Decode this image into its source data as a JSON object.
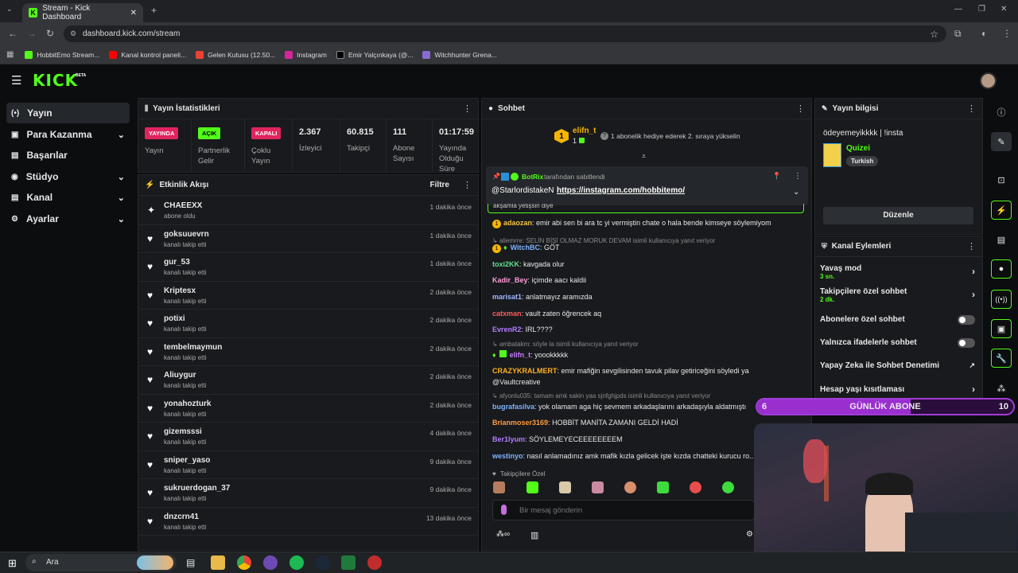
{
  "browser": {
    "tab_title": "Stream - Kick Dashboard",
    "url": "dashboard.kick.com/stream",
    "bookmarks": [
      "HobbitEmo Stream...",
      "Kanal kontrol paneli...",
      "Gelen Kutusu (12.50...",
      "Instagram",
      "Emir Yalçınkaya (@...",
      "Witchhunter Grena..."
    ]
  },
  "brand": {
    "logo": "KICK",
    "beta": "BETA",
    "accent": "#53fc18"
  },
  "sidebar": {
    "items": [
      {
        "label": "Yayın"
      },
      {
        "label": "Para Kazanma"
      },
      {
        "label": "Başarılar"
      },
      {
        "label": "Stüdyo"
      },
      {
        "label": "Kanal"
      },
      {
        "label": "Ayarlar"
      }
    ]
  },
  "stats": {
    "title": "Yayın İstatistikleri",
    "items": [
      {
        "badge": "YAYINDA",
        "label": "Yayın"
      },
      {
        "badge": "AÇIK",
        "label": "Partnerlik Gelir"
      },
      {
        "badge": "KAPALI",
        "label": "Çoklu Yayın"
      },
      {
        "value": "2.367",
        "label": "İzleyici"
      },
      {
        "value": "60.815",
        "label": "Takipçi"
      },
      {
        "value": "111",
        "label": "Abone Sayısı"
      },
      {
        "value": "01:17:59",
        "label": "Yayında Olduğu Süre"
      }
    ]
  },
  "activity": {
    "title": "Etkinlik Akışı",
    "filter": "Filtre",
    "events": [
      {
        "name": "CHAEEXX",
        "desc": "abone oldu",
        "time": "1 dakika önce"
      },
      {
        "name": "goksuuevrn",
        "desc": "kanalı takip etti",
        "time": "1 dakika önce"
      },
      {
        "name": "gur_53",
        "desc": "kanalı takip etti",
        "time": "1 dakika önce"
      },
      {
        "name": "Kriptesx",
        "desc": "kanalı takip etti",
        "time": "2 dakika önce"
      },
      {
        "name": "potixi",
        "desc": "kanalı takip etti",
        "time": "2 dakika önce"
      },
      {
        "name": "tembelmaymun",
        "desc": "kanalı takip etti",
        "time": "2 dakika önce"
      },
      {
        "name": "Aliuygur",
        "desc": "kanalı takip etti",
        "time": "2 dakika önce"
      },
      {
        "name": "yonahozturk",
        "desc": "kanalı takip etti",
        "time": "2 dakika önce"
      },
      {
        "name": "gizemsssi",
        "desc": "kanalı takip etti",
        "time": "4 dakika önce"
      },
      {
        "name": "sniper_yaso",
        "desc": "kanalı takip etti",
        "time": "9 dakika önce"
      },
      {
        "name": "sukruerdogan_37",
        "desc": "kanalı takip etti",
        "time": "9 dakika önce"
      },
      {
        "name": "dnzcrn41",
        "desc": "kanalı takip etti",
        "time": "13 dakika önce"
      }
    ]
  },
  "chat": {
    "title": "Sohbet",
    "top_user": "elifn_t",
    "top_rank": "1",
    "top_count": "1",
    "top_text": "1 abonelik hediye ederek 2. sıraya yükselin",
    "pinned_by": "BotRix",
    "pinned_suffix": "tarafından sabitlendi",
    "pinned_mention": "@StarlordistakeN",
    "pinned_link": "https://instagram.com/hobbitemo/",
    "partial_top": "akşamla yetişsin diye",
    "messages": [
      {
        "user": "adaozan",
        "text": "emir abi sen bi ara tc yi vermiştin chate o hala bende kimseye söylemiyom",
        "color": "#f5c542"
      },
      {
        "reply": "aliemrre: SELİN BİŞİ OLMAZ MORUK DEVAM isimli kullanıcıya yanıt veriyor"
      },
      {
        "user": "WitchBC",
        "text": "GÖT",
        "color": "#7fb2ff"
      },
      {
        "user": "toxi2KK",
        "text": "kavgada olur",
        "color": "#5ee08f"
      },
      {
        "user": "Kadir_Bey",
        "text": "içimde aacı kaldii",
        "color": "#ff9ad8"
      },
      {
        "user": "marisat1",
        "text": "anlatmayız aramızda",
        "color": "#9fb7ff"
      },
      {
        "user": "catxman",
        "text": "vault zaten öğrencek aq",
        "color": "#ff5b5b"
      },
      {
        "user": "EvrenR2",
        "text": "IRL????",
        "color": "#b37cff"
      },
      {
        "reply": "ambatakm: söyle la isimli kullanıcıya yanıt veriyor"
      },
      {
        "user": "elifn_t",
        "text": "yoookkkkk",
        "color": "#c77dff"
      },
      {
        "user": "CRAZYKRALMERT",
        "text": "emir mafiğin sevgilisinden tavuk pilav getiriceğini söyledi ya",
        "color": "#ffb020"
      },
      {
        "cont": "@Vaultcreative"
      },
      {
        "reply": "afyonlu035: tamam amk sakin yaa sjnfghjpds isimli kullanıcıya yanıt veriyor"
      },
      {
        "user": "bugrafasilva",
        "text": "yok olamam aga hiç sevmem arkadaşlarını arkadaşıyla aldatmıştı",
        "color": "#7fb2ff"
      },
      {
        "user": "Brianmoser3169",
        "text": "HOBBİT MANİTA ZAMANI GELDİ HADİ",
        "color": "#ff9a3c"
      },
      {
        "user": "Ber1lyum",
        "text": "SÖYLEMEYECEEEEEEEEM",
        "color": "#b37cff"
      },
      {
        "user": "westinyo",
        "text": "nasıl anlamadınız amk mafik kızla gelicek işte kızda chatteki kurucu ro...",
        "color": "#7fb2ff"
      }
    ],
    "followers_only": "Takipçilere Özel",
    "input_placeholder": "Bir mesaj gönderin"
  },
  "info": {
    "title": "Yayın bilgisi",
    "stream_title": "ödeyemeyikkkk | !insta",
    "category": "Quizei",
    "language": "Turkish",
    "edit": "Düzenle"
  },
  "actions": {
    "title": "Kanal Eylemleri",
    "items": [
      {
        "label": "Yavaş mod",
        "sub": "3 sn."
      },
      {
        "label": "Takipçilere özel sohbet",
        "sub": "2 dk."
      },
      {
        "label": "Abonelere özel sohbet"
      },
      {
        "label": "Yalnızca ifadelerle sohbet"
      },
      {
        "label": "Yapay Zeka ile Sohbet Denetimi"
      },
      {
        "label": "Hesap yaşı kısıtlaması"
      }
    ]
  },
  "overlay": {
    "left": "6",
    "title": "GÜNLÜK ABONE",
    "right": "10",
    "progress": 0.6
  },
  "taskbar": {
    "search": "Ara"
  }
}
